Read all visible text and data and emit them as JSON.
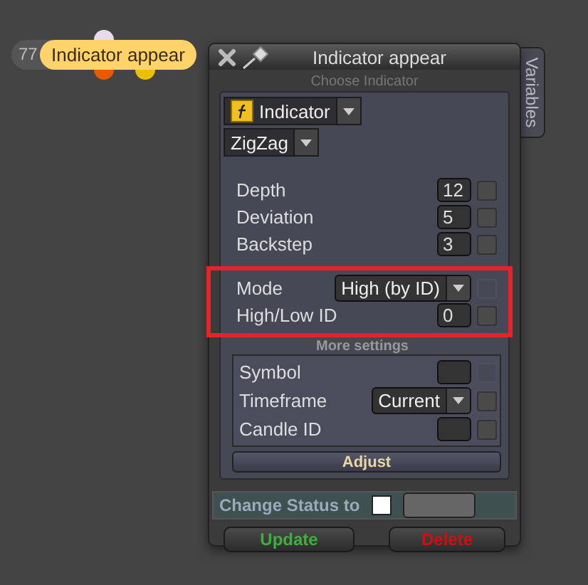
{
  "node": {
    "count": "77",
    "label": "Indicator appear"
  },
  "window": {
    "title": "Indicator appear",
    "side_tab": "Variables"
  },
  "choose_label": "Choose Indicator",
  "indicator_type": "Indicator",
  "indicator": "ZigZag",
  "sections": [
    {
      "highlighted": false,
      "rows": [
        {
          "label": "Depth",
          "kind": "input",
          "value": "12",
          "checkbox_disabled": false
        },
        {
          "label": "Deviation",
          "kind": "input",
          "value": "5",
          "checkbox_disabled": false
        },
        {
          "label": "Backstep",
          "kind": "input",
          "value": "3",
          "checkbox_disabled": false
        }
      ]
    },
    {
      "highlighted": true,
      "rows": [
        {
          "label": "Mode",
          "kind": "select",
          "value": "High (by ID)",
          "checkbox_disabled": true
        },
        {
          "label": "High/Low ID",
          "kind": "input",
          "value": "0",
          "checkbox_disabled": false
        }
      ]
    }
  ],
  "more_settings": {
    "title": "More settings",
    "rows": [
      {
        "label": "Symbol",
        "kind": "input",
        "value": null,
        "checkbox_disabled": true
      },
      {
        "label": "Timeframe",
        "kind": "select",
        "value": "Current",
        "checkbox_disabled": false
      },
      {
        "label": "Candle ID",
        "kind": "input",
        "value": null,
        "checkbox_disabled": false
      }
    ]
  },
  "adjust_button": "Adjust",
  "change_status": {
    "label": "Change Status to"
  },
  "buttons": [
    {
      "label": "Update",
      "kind": "update"
    },
    {
      "label": "Delete",
      "kind": "delete"
    }
  ]
}
